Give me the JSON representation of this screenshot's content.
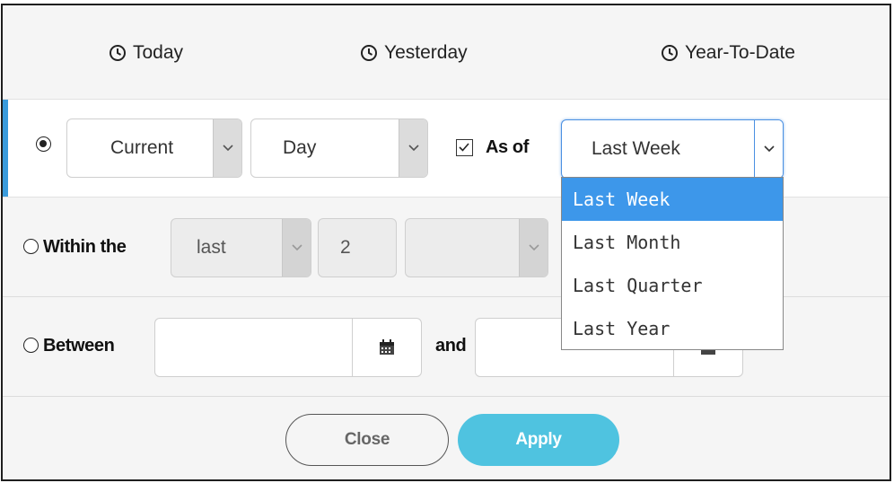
{
  "quick_ranges": [
    {
      "label": "Today",
      "icon": "clock-icon"
    },
    {
      "label": "Yesterday",
      "icon": "clock-icon"
    },
    {
      "label": "Year-To-Date",
      "icon": "clock-icon"
    }
  ],
  "current_row": {
    "selected": true,
    "period_select": {
      "value": "Current"
    },
    "unit_select": {
      "value": "Day"
    },
    "as_of_checkbox": {
      "checked": true,
      "label": "As of"
    },
    "as_of_select": {
      "value": "Last Week"
    }
  },
  "within_row": {
    "selected": false,
    "label": "Within the",
    "direction_select": {
      "value": "last"
    },
    "count_input": {
      "value": "2"
    },
    "unit_select": {
      "value": ""
    }
  },
  "between_row": {
    "selected": false,
    "label": "Between",
    "and_label": "and",
    "start_date": {
      "value": ""
    },
    "end_date": {
      "value": ""
    }
  },
  "as_of_dropdown": {
    "options": [
      "Last Week",
      "Last Month",
      "Last Quarter",
      "Last Year"
    ],
    "selected_index": 0
  },
  "actions": {
    "close_label": "Close",
    "apply_label": "Apply"
  },
  "colors": {
    "accent": "#3a9bdc",
    "apply": "#4fc3e0",
    "dropdown_highlight": "#3d97ea"
  }
}
